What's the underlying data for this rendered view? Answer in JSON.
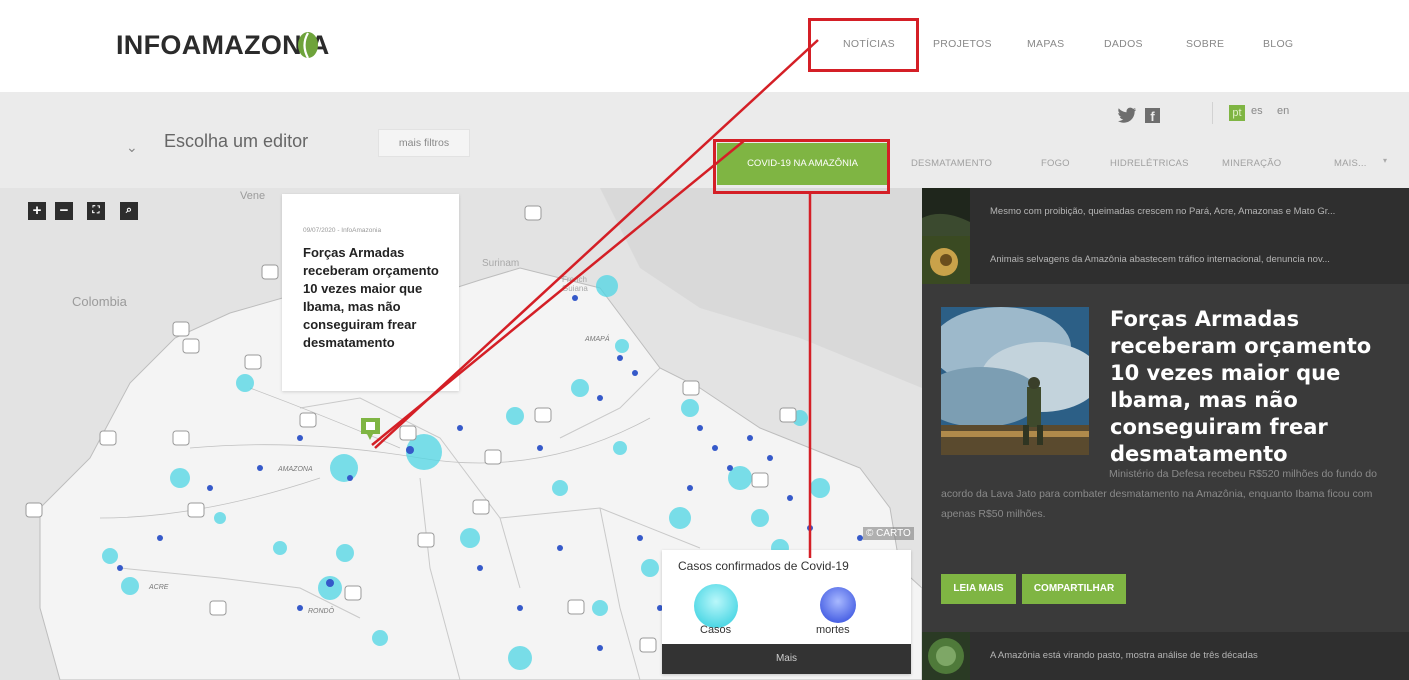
{
  "brand": {
    "name": "INFOAMAZONIA",
    "leaf_color": "#6ea33b"
  },
  "nav": {
    "items": [
      {
        "label": "NOTÍCIAS"
      },
      {
        "label": "PROJETOS"
      },
      {
        "label": "MAPAS"
      },
      {
        "label": "DADOS"
      },
      {
        "label": "SOBRE"
      },
      {
        "label": "BLOG"
      }
    ]
  },
  "filters": {
    "editor_label": "Escolha um editor",
    "more_filters": "mais filtros",
    "social": {
      "twitter": "twitter-icon",
      "facebook": "facebook-icon"
    },
    "languages": [
      "pt",
      "es",
      "en"
    ]
  },
  "tabs": {
    "active": "COVID-19 NA AMAZÔNIA",
    "items": [
      "DESMATAMENTO",
      "FOGO",
      "HIDRELÉTRICAS",
      "MINERAÇÃO",
      "MAIS..."
    ]
  },
  "map": {
    "controls": [
      "zoom-in-icon",
      "zoom-out-icon",
      "fullscreen-icon",
      "search-icon"
    ],
    "place_labels": [
      "Vene",
      "Colombia",
      "Surinam",
      "French Guiana",
      "AMAPÁ",
      "AMAZONA",
      "ACRE",
      "RONDÔ"
    ],
    "popup": {
      "meta": "09/07/2020 - InfoAmazonia",
      "title": "Forças Armadas receberam orçamento 10 vezes maior que Ibama, mas não conseguiram frear desmatamento"
    },
    "attribution": "© CARTO",
    "legend": {
      "title": "Casos confirmados de Covid-19",
      "cases_label": "Casos",
      "deaths_label": "mortes",
      "more": "Mais",
      "cases_color": "#4fd6e4",
      "deaths_color": "#4b63e3"
    }
  },
  "sidebar": {
    "list_top": [
      {
        "text": "Mesmo com proibição, queimadas crescem no Pará, Acre, Amazonas e Mato Gr..."
      },
      {
        "text": "Animais selvagens da Amazônia abastecem tráfico internacional, denuncia nov..."
      }
    ],
    "featured": {
      "title": "Forças Armadas receberam orçamento 10 vezes maior que Ibama, mas não conseguiram frear desmatamento",
      "description": "Ministério da Defesa recebeu R$520 milhões do fundo do acordo da Lava Jato para combater desmatamento na Amazônia, enquanto Ibama ficou com apenas R$50 milhões.",
      "read_more": "LEIA MAIS",
      "share": "COMPARTILHAR"
    },
    "list_bottom": [
      {
        "text": "A Amazônia está virando pasto, mostra análise de três décadas"
      }
    ]
  },
  "colors": {
    "accent_green": "#7fb543",
    "annotation_red": "#d41f26"
  }
}
